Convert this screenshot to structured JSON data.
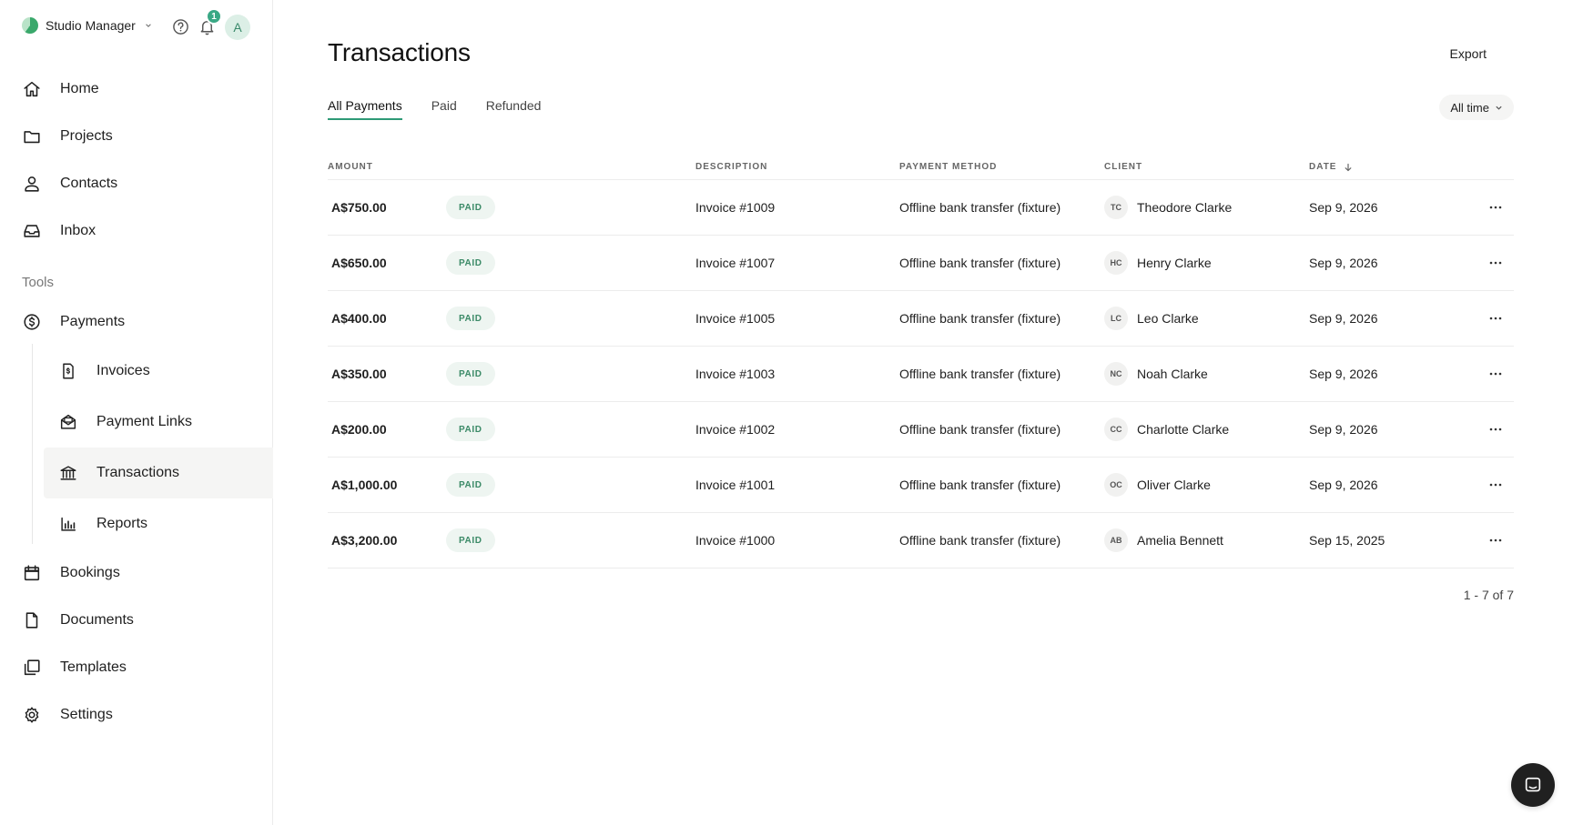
{
  "app": {
    "name": "Studio Manager",
    "notification_count": "1",
    "avatar_initial": "A"
  },
  "nav": {
    "main": [
      {
        "label": "Home",
        "icon": "home-icon"
      },
      {
        "label": "Projects",
        "icon": "folder-icon"
      },
      {
        "label": "Contacts",
        "icon": "person-icon"
      },
      {
        "label": "Inbox",
        "icon": "inbox-icon"
      }
    ],
    "tools_label": "Tools",
    "payments": {
      "label": "Payments",
      "icon": "dollar-circle-icon"
    },
    "payments_sub": [
      {
        "label": "Invoices",
        "icon": "invoice-icon"
      },
      {
        "label": "Payment Links",
        "icon": "payment-link-icon"
      },
      {
        "label": "Transactions",
        "icon": "bank-icon",
        "active": true
      },
      {
        "label": "Reports",
        "icon": "bar-chart-icon"
      }
    ],
    "more": [
      {
        "label": "Bookings",
        "icon": "calendar-icon"
      },
      {
        "label": "Documents",
        "icon": "document-icon"
      },
      {
        "label": "Templates",
        "icon": "templates-icon"
      },
      {
        "label": "Settings",
        "icon": "gear-icon"
      }
    ]
  },
  "page": {
    "title": "Transactions",
    "export_label": "Export",
    "tabs": [
      {
        "label": "All Payments",
        "active": true
      },
      {
        "label": "Paid"
      },
      {
        "label": "Refunded"
      }
    ],
    "range_label": "All time"
  },
  "table": {
    "columns": {
      "amount": "AMOUNT",
      "description": "DESCRIPTION",
      "payment_method": "PAYMENT METHOD",
      "client": "CLIENT",
      "date": "DATE"
    },
    "rows": [
      {
        "amount": "A$750.00",
        "status": "PAID",
        "description": "Invoice #1009",
        "method": "Offline bank transfer (fixture)",
        "initials": "TC",
        "client": "Theodore Clarke",
        "date": "Sep 9, 2026"
      },
      {
        "amount": "A$650.00",
        "status": "PAID",
        "description": "Invoice #1007",
        "method": "Offline bank transfer (fixture)",
        "initials": "HC",
        "client": "Henry Clarke",
        "date": "Sep 9, 2026"
      },
      {
        "amount": "A$400.00",
        "status": "PAID",
        "description": "Invoice #1005",
        "method": "Offline bank transfer (fixture)",
        "initials": "LC",
        "client": "Leo Clarke",
        "date": "Sep 9, 2026"
      },
      {
        "amount": "A$350.00",
        "status": "PAID",
        "description": "Invoice #1003",
        "method": "Offline bank transfer (fixture)",
        "initials": "NC",
        "client": "Noah Clarke",
        "date": "Sep 9, 2026"
      },
      {
        "amount": "A$200.00",
        "status": "PAID",
        "description": "Invoice #1002",
        "method": "Offline bank transfer (fixture)",
        "initials": "CC",
        "client": "Charlotte Clarke",
        "date": "Sep 9, 2026"
      },
      {
        "amount": "A$1,000.00",
        "status": "PAID",
        "description": "Invoice #1001",
        "method": "Offline bank transfer (fixture)",
        "initials": "OC",
        "client": "Oliver Clarke",
        "date": "Sep 9, 2026"
      },
      {
        "amount": "A$3,200.00",
        "status": "PAID",
        "description": "Invoice #1000",
        "method": "Offline bank transfer (fixture)",
        "initials": "AB",
        "client": "Amelia Bennett",
        "date": "Sep 15, 2025"
      }
    ],
    "pagination": "1 - 7 of 7"
  },
  "colors": {
    "accent": "#2e9a76",
    "paid_pill_bg": "#eef5f1",
    "paid_pill_text": "#3b8a67"
  }
}
